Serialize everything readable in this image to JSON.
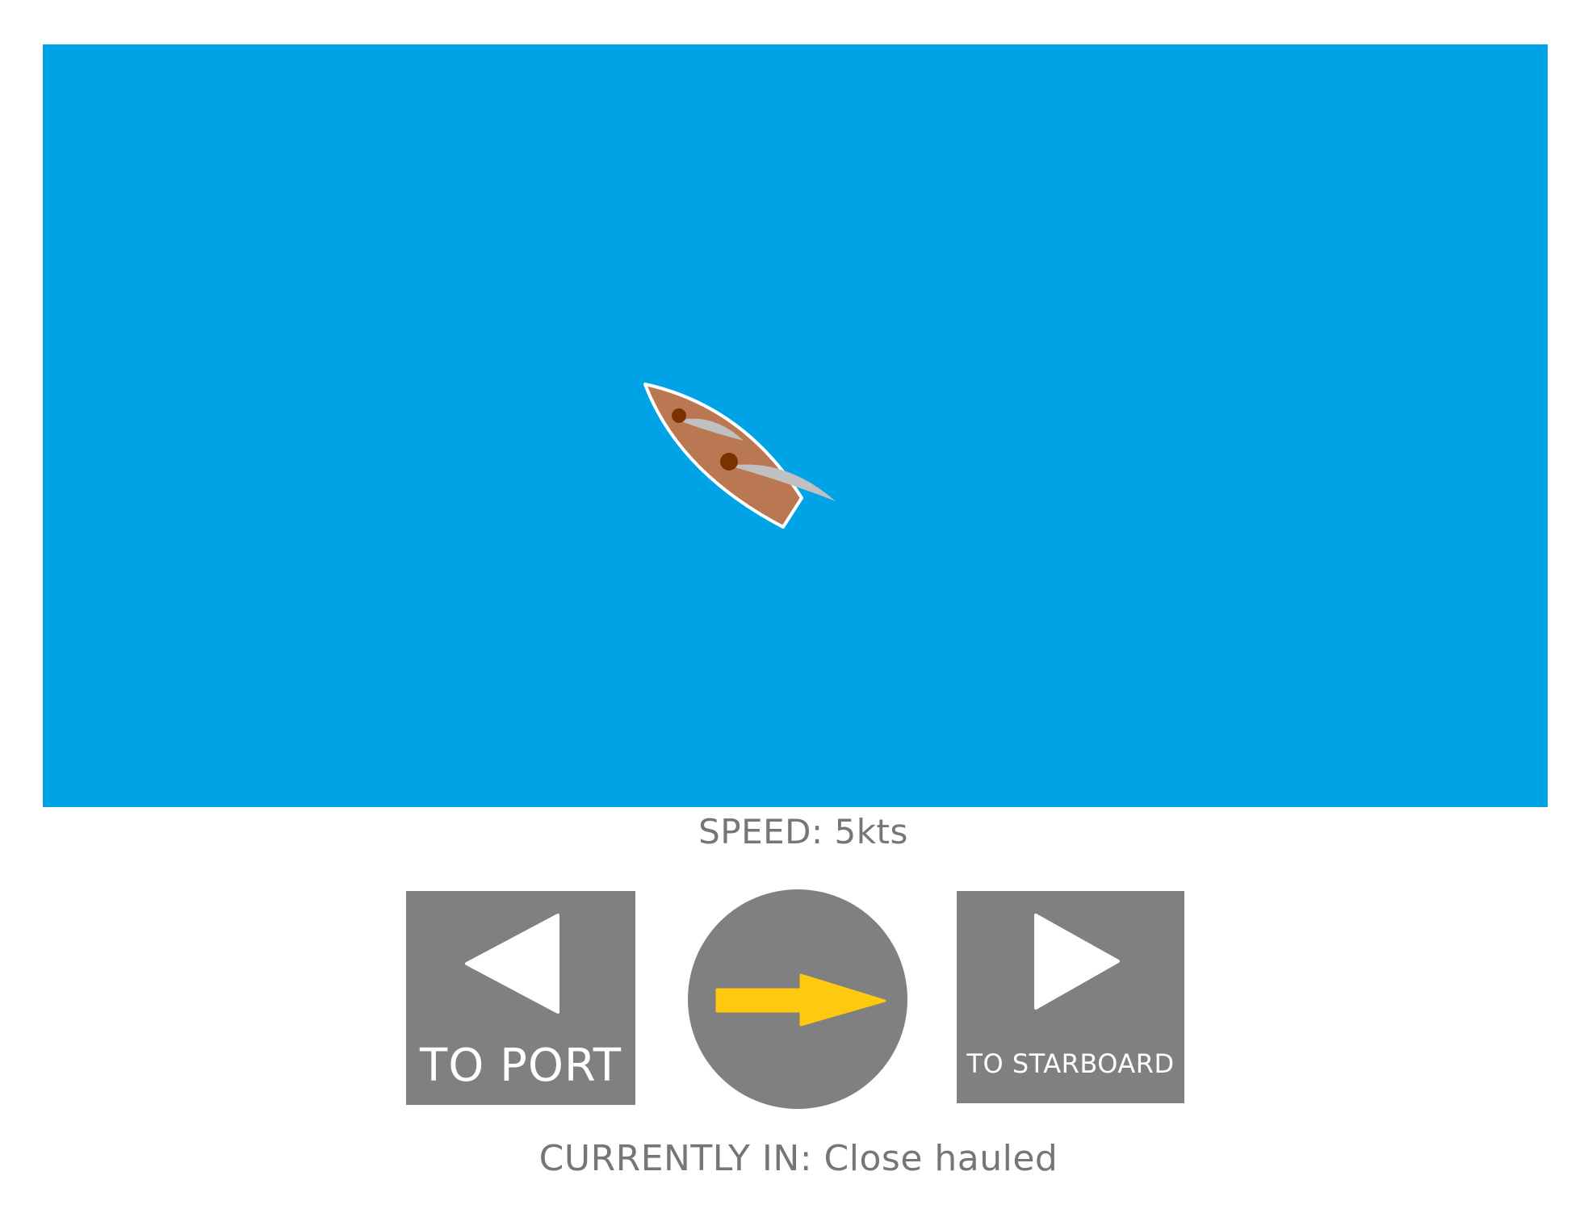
{
  "speed": {
    "label": "SPEED:",
    "value": "5kts",
    "text": "SPEED: 5kts"
  },
  "controls": {
    "port_label": "TO PORT",
    "starboard_label": "TO STARBOARD"
  },
  "status": {
    "text": "CURRENTLY IN: Close hauled"
  },
  "colors": {
    "sea": "#00a3e6",
    "hull": "#b97852",
    "mast": "#7a3300",
    "sail": "#c0c0c0",
    "button": "#808080",
    "wind_arrow": "#ffc90e",
    "text": "#767676"
  },
  "icons": {
    "port_button": "triangle-left-icon",
    "starboard_button": "triangle-right-icon",
    "wind_indicator": "wind-arrow-right-icon",
    "boat": "sailboat-icon"
  }
}
